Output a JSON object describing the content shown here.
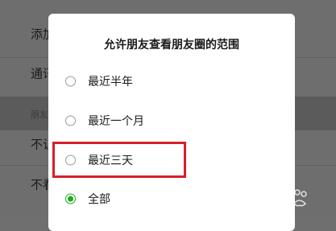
{
  "background": {
    "rows": [
      {
        "label": "添加"
      },
      {
        "label": "通讯"
      },
      {
        "label": "不让"
      },
      {
        "label": "不看"
      }
    ],
    "section_label": "朋友"
  },
  "dialog": {
    "title": "允许朋友查看朋友圈的范围",
    "options": [
      {
        "label": "最近半年",
        "selected": false
      },
      {
        "label": "最近一个月",
        "selected": false
      },
      {
        "label": "最近三天",
        "selected": false
      },
      {
        "label": "全部",
        "selected": true
      }
    ]
  },
  "watermark": {
    "text": "Baidu经验"
  },
  "colors": {
    "accent": "#1aad19",
    "highlight": "#d5202a"
  }
}
